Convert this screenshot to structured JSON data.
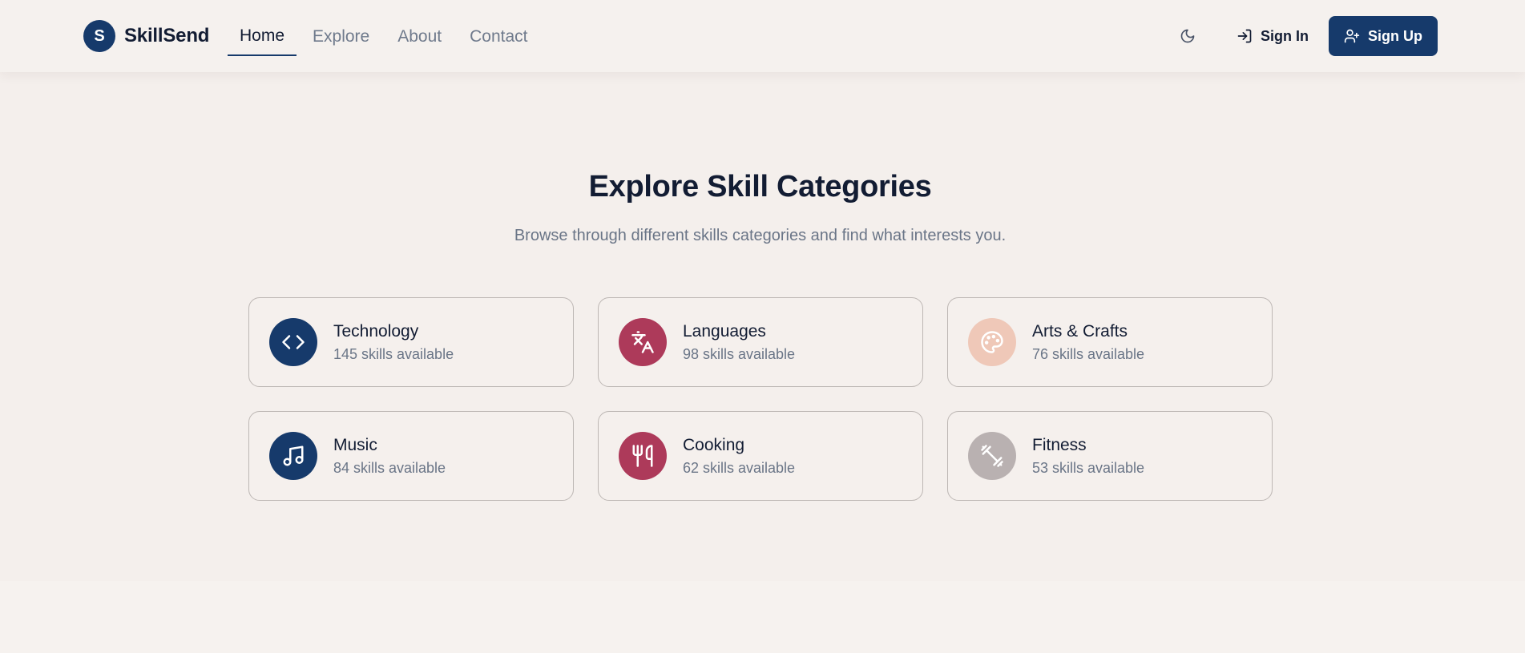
{
  "brand": {
    "logo_letter": "S",
    "name": "SkillSend"
  },
  "nav": {
    "links": [
      {
        "label": "Home",
        "active": true
      },
      {
        "label": "Explore",
        "active": false
      },
      {
        "label": "About",
        "active": false
      },
      {
        "label": "Contact",
        "active": false
      }
    ]
  },
  "actions": {
    "theme_icon": "moon-icon",
    "signin_label": "Sign In",
    "signup_label": "Sign Up"
  },
  "section": {
    "title": "Explore Skill Categories",
    "subtitle": "Browse through different skills categories and find what interests you."
  },
  "categories": [
    {
      "name": "Technology",
      "count_text": "145 skills available",
      "icon": "code-icon",
      "color": "#163a6b"
    },
    {
      "name": "Languages",
      "count_text": "98 skills available",
      "icon": "translate-icon",
      "color": "#ad3a5a"
    },
    {
      "name": "Arts & Crafts",
      "count_text": "76 skills available",
      "icon": "palette-icon",
      "color": "#efc8b8"
    },
    {
      "name": "Music",
      "count_text": "84 skills available",
      "icon": "music-icon",
      "color": "#163a6b"
    },
    {
      "name": "Cooking",
      "count_text": "62 skills available",
      "icon": "utensils-icon",
      "color": "#ad3a5a"
    },
    {
      "name": "Fitness",
      "count_text": "53 skills available",
      "icon": "dumbbell-icon",
      "color": "#b9b1b1"
    }
  ],
  "colors": {
    "primary": "#163a6b",
    "accent": "#ad3a5a",
    "background": "#f5f1ee"
  }
}
